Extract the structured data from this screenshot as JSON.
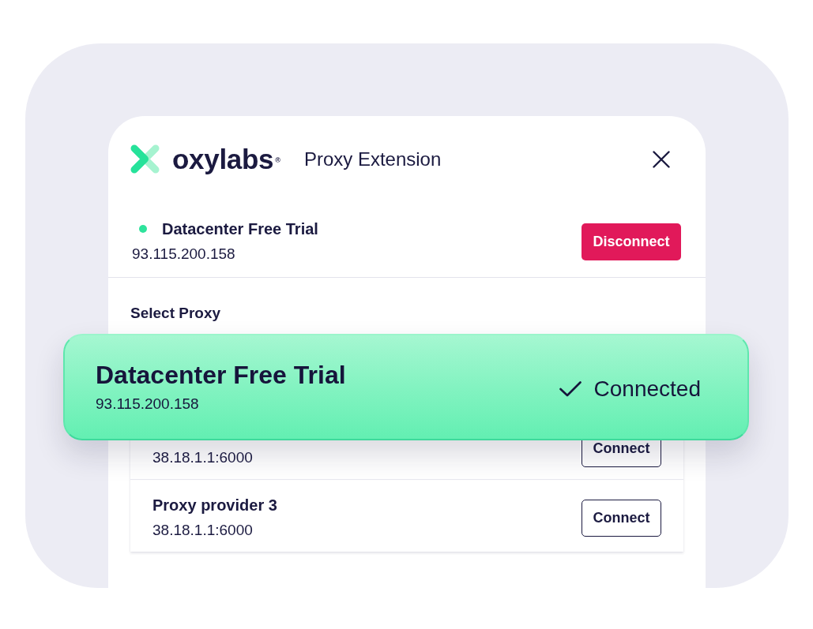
{
  "header": {
    "logo": "oxylabs$^{®}$",
    "title": "Proxy Extension"
  },
  "status": {
    "connected": true,
    "name": "Datacenter Free Trial",
    "address": "93.115.200.158",
    "button": "Disconnect"
  },
  "section_label": "Select Proxy",
  "active_proxy": {
    "name": "Datacenter Free Trial",
    "address": "93.115.200.158",
    "connected": true,
    "status": "Connected"
  },
  "proxies": [
    {
      "address": "38.18.1.1:6000",
      "button": "Connect"
    },
    {
      "name": "Proxy provider 3",
      "address": "38.18.1.1:6000",
      "button": "Connect"
    }
  ]
}
